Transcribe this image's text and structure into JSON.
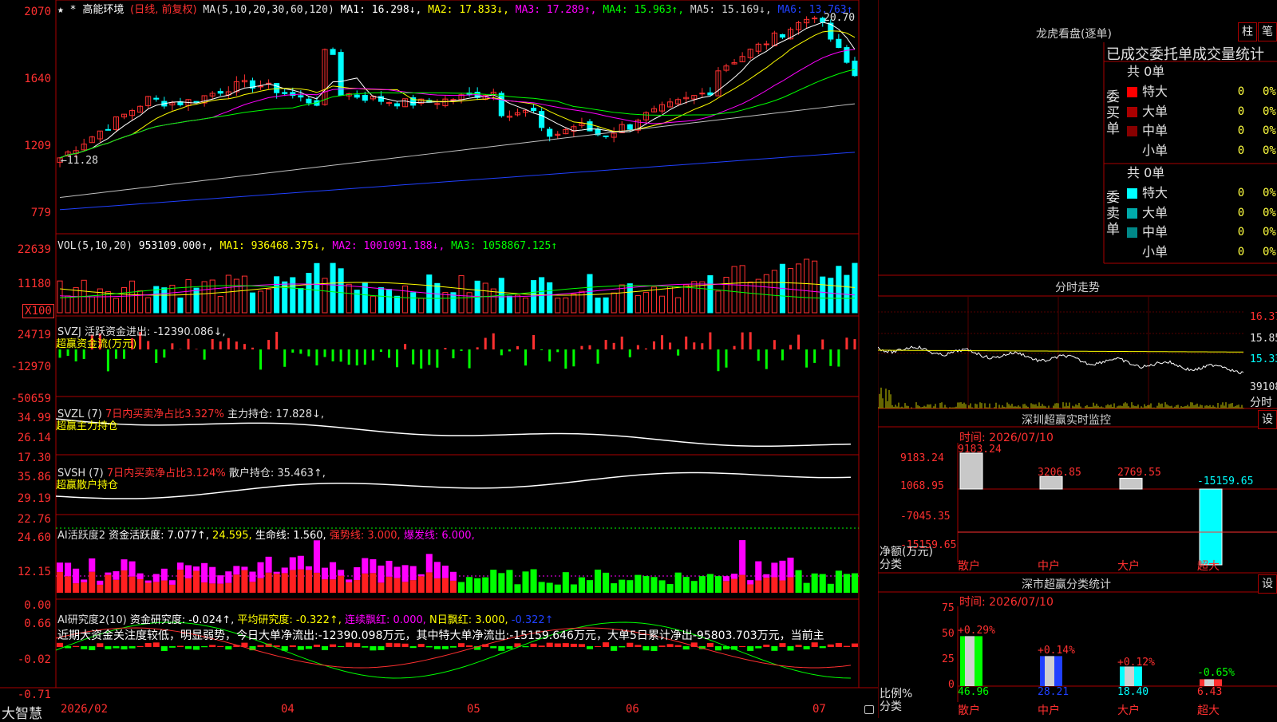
{
  "app_name": "大智慧",
  "price_axis": [
    "2070",
    "1640",
    "1209",
    "779"
  ],
  "vol_axis": [
    "22639",
    "11180",
    "X100"
  ],
  "svzj_axis": [
    "24719",
    "-12970",
    "-50659"
  ],
  "svzl_axis": [
    "34.99",
    "26.14",
    "17.30"
  ],
  "svsh_axis": [
    "35.86",
    "29.19",
    "22.76"
  ],
  "ai1_axis": [
    "24.60",
    "12.15",
    "0.00"
  ],
  "ai2_axis": [
    "0.66",
    "-0.02",
    "-0.71"
  ],
  "main_info": {
    "stars": "★ *",
    "name": "高能环境",
    "period": "(日线, 前复权)",
    "ma_def": "MA(5,10,20,30,60,120)",
    "ma1": "MA1: 16.298↓,",
    "ma2": "MA2: 17.833↓,",
    "ma3": "MA3: 17.289↑,",
    "ma4": "MA4: 15.963↑,",
    "ma5": "MA5: 15.169↓,",
    "ma6": "MA6: 13.763↑"
  },
  "hi_label": "20.70",
  "lo_label": "←11.28",
  "vol_info": {
    "def": "VOL(5,10,20)",
    "val": "953109.000↑,",
    "ma1": "MA1: 936468.375↓,",
    "ma2": "MA2: 1001091.188↓,",
    "ma3": "MA3: 1058867.125↑"
  },
  "svzj_info": {
    "def": "SVZJ",
    "text": "活跃资金进出: -12390.086↓,",
    "sub": "超赢资金流(万元)"
  },
  "svzl_info": {
    "def": "SVZL (7)",
    "red": "7日内买卖净占比3.327%",
    "text": "主力持仓: 17.828↓,",
    "sub": "超赢主力持仓"
  },
  "svsh_info": {
    "def": "SVSH (7)",
    "red": "7日内买卖净占比3.124%",
    "text": "散户持仓: 35.463↑,",
    "sub": "超赢散户持仓"
  },
  "ai1_info": {
    "def": "AI活跃度2",
    "text": "资金活跃度: 7.077↑,",
    "v2": "24.595,",
    "life": "生命线: 1.560,",
    "strong": "强势线: 3.000,",
    "burst": "爆发线: 6.000,"
  },
  "ai2_info": {
    "def": "AI研究度2(10)",
    "text": "资金研究度: -0.024↑,",
    "avg": "平均研究度: -0.322↑,",
    "lian": "连续飘红: 0.000,",
    "nday": "N日飘红: 3.000,",
    "last": "-0.322↑"
  },
  "ai2_comment": "近期大资金关注度较低，明显弱势，今日大单净流出:-12390.098万元，其中特大单净流出:-15159.646万元，大单5日累计净出-95803.703万元，当前主",
  "date_axis": [
    "2026/02",
    "04",
    "05",
    "06",
    "07"
  ],
  "lhb": {
    "title": "龙虎看盘(逐单)",
    "btn1": "柱",
    "btn2": "笔",
    "tabs": "已成交委托单成交量统计",
    "buy_label": "委买单",
    "sell_label": "委卖单",
    "buy_total": "共 0单",
    "sell_total": "共 0单",
    "rows": [
      {
        "label": "特大",
        "count": "0",
        "pct": "0%"
      },
      {
        "label": "大单",
        "count": "0",
        "pct": "0%"
      },
      {
        "label": "中单",
        "count": "0",
        "pct": "0%"
      },
      {
        "label": "小单",
        "count": "0",
        "pct": "0%"
      }
    ],
    "buy_colors": [
      "#ff0000",
      "#aa0000",
      "#880000",
      "#000000"
    ],
    "sell_colors": [
      "#00ffff",
      "#00aaaa",
      "#008888",
      "#000000"
    ]
  },
  "fenshi": {
    "title": "分时走势",
    "prices": [
      "16.37",
      "15.85",
      "15.33"
    ],
    "vol_label": "39108",
    "footer": "分时"
  },
  "monitor": {
    "title": "深圳超赢实时监控",
    "btn": "设",
    "time": "时间: 2026/07/10",
    "axis": [
      "9183.24",
      "1068.95",
      "-7045.35",
      "-15159.65"
    ],
    "left_label": "净额(万元)",
    "left_label2": "分类",
    "bars": [
      {
        "cat": "散户",
        "value": 9183.24,
        "label": "9183.24"
      },
      {
        "cat": "中户",
        "value": 3206.85,
        "label": "3206.85"
      },
      {
        "cat": "大户",
        "value": 2769.55,
        "label": "2769.55"
      },
      {
        "cat": "超大",
        "value": -15159.65,
        "label": "-15159.65"
      }
    ]
  },
  "stat": {
    "title": "深市超赢分类统计",
    "btn": "设",
    "time": "时间: 2026/07/10",
    "axis": [
      "75",
      "50",
      "25",
      "0"
    ],
    "left_label": "比例%",
    "left_label2": "分类",
    "bars": [
      {
        "cat": "散户",
        "value": 46.96,
        "label": "46.96",
        "chg": "+0.29%"
      },
      {
        "cat": "中户",
        "value": 28.21,
        "label": "28.21",
        "chg": "+0.14%"
      },
      {
        "cat": "大户",
        "value": 18.4,
        "label": "18.40",
        "chg": "+0.12%"
      },
      {
        "cat": "超大",
        "value": 6.43,
        "label": "6.43",
        "chg": "-0.65%"
      }
    ]
  }
}
